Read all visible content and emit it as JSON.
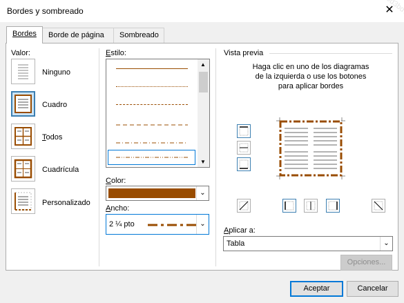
{
  "window": {
    "title": "Bordes y sombreado",
    "close_glyph": "✕"
  },
  "watermark": "bd-d6cb-4761-8faf-89e0-b3-e8d3bd7f01c6",
  "tabs": [
    {
      "label": "Bordes",
      "active": true
    },
    {
      "label": "Borde de página",
      "active": false
    },
    {
      "label": "Sombreado",
      "active": false
    }
  ],
  "setting": {
    "label": "Valor:",
    "options": [
      {
        "label": "Ninguno",
        "icon": "border-none-icon"
      },
      {
        "label": "Cuadro",
        "icon": "border-box-icon",
        "selected": true
      },
      {
        "label": "Todos",
        "icon": "border-all-icon"
      },
      {
        "label": "Cuadrícula",
        "icon": "border-grid-icon"
      },
      {
        "label": "Personalizado",
        "icon": "border-custom-icon"
      }
    ]
  },
  "style": {
    "label": "Estilo:",
    "line_styles": [
      "solid",
      "dotted",
      "dashed",
      "long-dash",
      "dash-dot",
      "dash-dot-dot"
    ]
  },
  "color": {
    "label": "Color:",
    "value": "#994c00"
  },
  "width": {
    "label": "Ancho:",
    "value": "2 ¼ pto"
  },
  "preview": {
    "label": "Vista previa",
    "hint": "Haga clic en uno de los diagramas de la izquierda o use los botones para aplicar bordes",
    "border_color": "#994c00"
  },
  "apply_to": {
    "label": "Aplicar a:",
    "value": "Tabla"
  },
  "buttons": {
    "options": "Opciones...",
    "ok": "Aceptar",
    "cancel": "Cancelar"
  },
  "colors": {
    "accent": "#0078d7",
    "selection": "#cce4f7",
    "border_brown": "#994c00"
  }
}
